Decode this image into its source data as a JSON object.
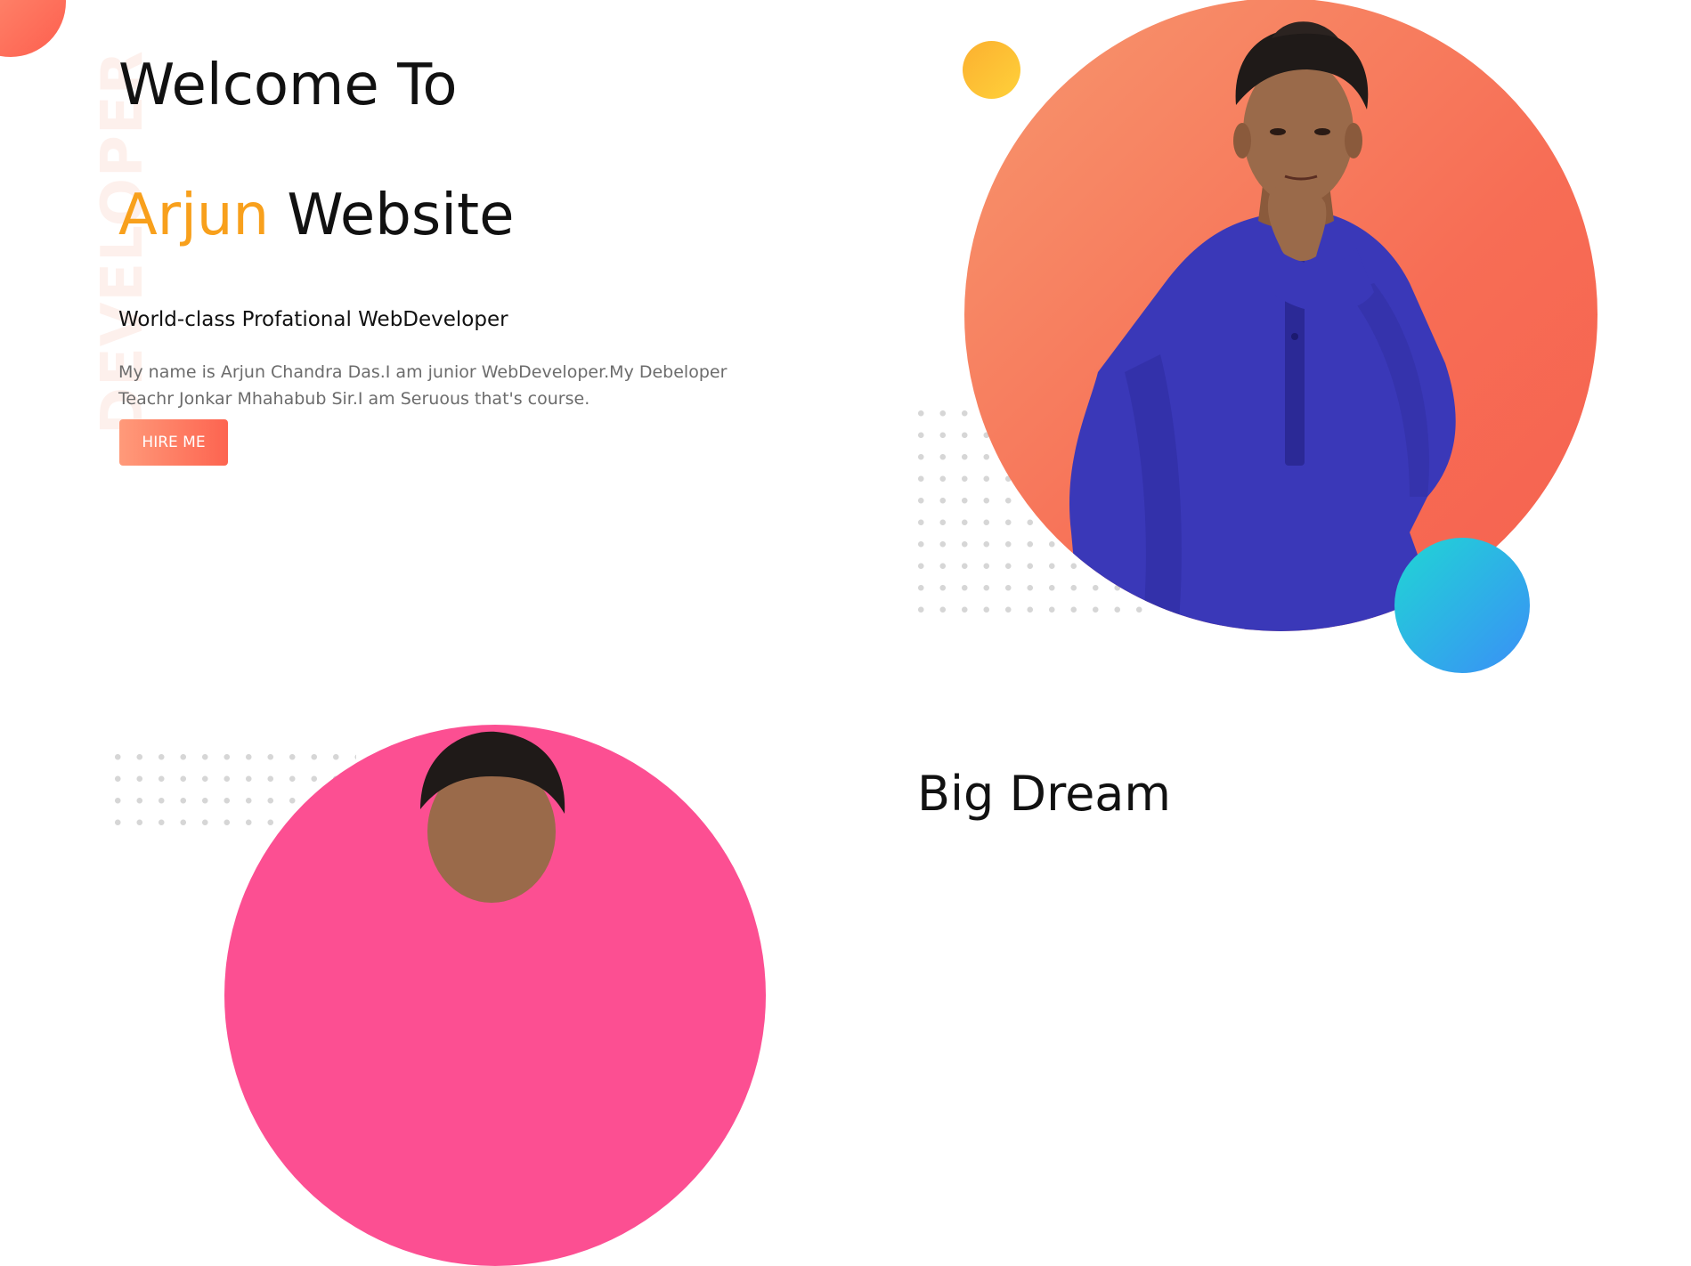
{
  "hero": {
    "vertical_word": "DEVELOPER",
    "title_line1": "Welcome To",
    "title_highlight": "Arjun",
    "title_rest": " Website",
    "subtitle": "World-class Profational WebDeveloper",
    "description": "My name is Arjun Chandra Das.I am junior WebDeveloper.My Debeloper Teachr Jonkar Mhahabub Sir.I am Seruous that's course.",
    "hire_button": "HIRE ME"
  },
  "about": {
    "heading": "Big Dream"
  },
  "colors": {
    "accent": "#f8a01c",
    "button_gradient": [
      "#ff9a7a",
      "#fd6450"
    ],
    "hero_circle": "#f76d55",
    "yellow_dot": "#fcb030",
    "blue_dot": "#3a8ff7",
    "pink_circle": "#fc4f92"
  }
}
